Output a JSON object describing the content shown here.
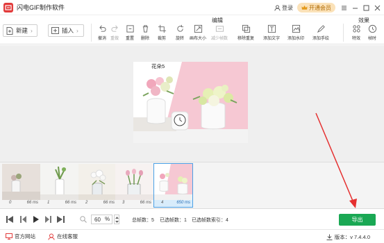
{
  "app": {
    "title": "闪电GIF制作软件",
    "login": "登录",
    "member": "开通会员"
  },
  "toolbar": {
    "new_label": "新建",
    "insert_label": "插入",
    "edit_group": "编辑",
    "effect_group": "效果",
    "tools": [
      {
        "label": "撤消",
        "icon": "undo-icon",
        "disabled": false
      },
      {
        "label": "重做",
        "icon": "redo-icon",
        "disabled": true
      },
      {
        "label": "重置",
        "icon": "reset-icon",
        "disabled": false
      },
      {
        "label": "删除",
        "icon": "delete-icon",
        "disabled": false
      },
      {
        "label": "裁剪",
        "icon": "crop-icon",
        "disabled": false
      },
      {
        "label": "旋转",
        "icon": "rotate-icon",
        "disabled": false
      },
      {
        "label": "画布大小",
        "icon": "canvas-size-icon",
        "disabled": false
      },
      {
        "label": "减少帧数",
        "icon": "reduce-frames-icon",
        "disabled": true
      },
      {
        "label": "移除重复",
        "icon": "remove-duplicates-icon",
        "disabled": false
      },
      {
        "label": "添加文字",
        "icon": "add-text-icon",
        "disabled": false
      },
      {
        "label": "添加水印",
        "icon": "add-watermark-icon",
        "disabled": false
      },
      {
        "label": "添加手绘",
        "icon": "add-drawing-icon",
        "disabled": false
      },
      {
        "label": "特效",
        "icon": "effects-icon",
        "disabled": false
      },
      {
        "label": "帧时",
        "icon": "frame-time-icon",
        "disabled": false
      }
    ]
  },
  "preview": {
    "frame_label": "花朵5"
  },
  "frames": [
    {
      "index": "0",
      "time": "66 ms"
    },
    {
      "index": "1",
      "time": "66 ms"
    },
    {
      "index": "2",
      "time": "66 ms"
    },
    {
      "index": "3",
      "time": "66 ms"
    },
    {
      "index": "4",
      "time": "650 ms"
    }
  ],
  "controls": {
    "zoom": "60",
    "zoom_unit": "%",
    "total_frames_label": "总帧数：",
    "total_frames": "5",
    "selected_frames_label": "已选帧数：",
    "selected_frames": "1",
    "selected_index_label": "已选帧数索引：",
    "selected_index": "4",
    "export_label": "导出"
  },
  "footer": {
    "website": "官方网站",
    "support": "在线客服",
    "version": "版本：v 7.4.4.0"
  },
  "colors": {
    "brand": "#e23b3b",
    "export": "#1aa854",
    "selection": "#4aa0e6",
    "annotation": "#e53030"
  }
}
